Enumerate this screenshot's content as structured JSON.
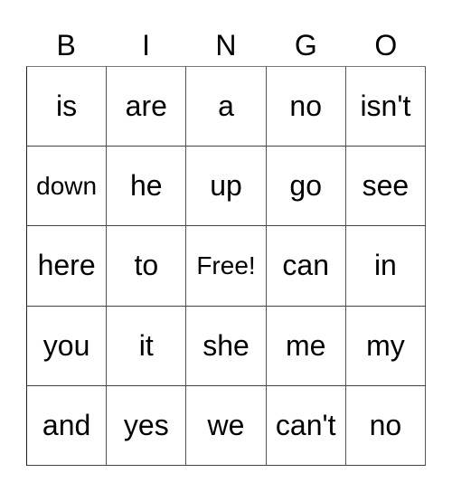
{
  "header": [
    "B",
    "I",
    "N",
    "G",
    "O"
  ],
  "cells": [
    [
      "is",
      "are",
      "a",
      "no",
      "isn't"
    ],
    [
      "down",
      "he",
      "up",
      "go",
      "see"
    ],
    [
      "here",
      "to",
      "Free!",
      "can",
      "in"
    ],
    [
      "you",
      "it",
      "she",
      "me",
      "my"
    ],
    [
      "and",
      "yes",
      "we",
      "can't",
      "no"
    ]
  ]
}
